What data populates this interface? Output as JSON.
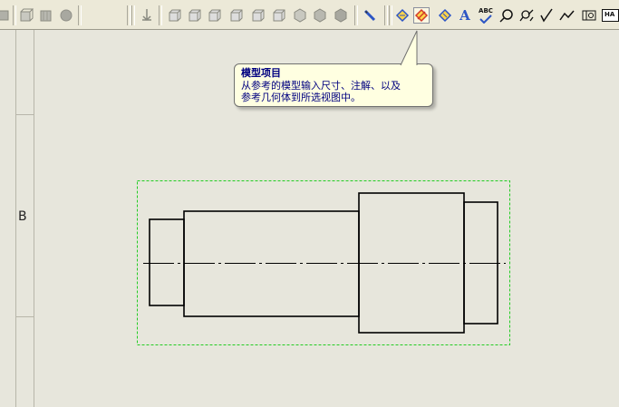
{
  "toolbar": {
    "tools": [
      {
        "name": "model-items"
      },
      {
        "name": "note"
      },
      {
        "name": "spell-checker"
      },
      {
        "name": "balloon"
      },
      {
        "name": "auto-balloon"
      },
      {
        "name": "surface-finish"
      },
      {
        "name": "weld-symbol"
      },
      {
        "name": "datum-feature"
      }
    ],
    "text_tool_glyph": "A",
    "spell_glyph": "ABC",
    "gtol_glyph": "HA"
  },
  "tooltip": {
    "title": "模型项目",
    "line1": "从参考的模型输入尺寸、注解、以及",
    "line2": "参考几何体到所选视图中。"
  },
  "sheet": {
    "zone_label": "B"
  },
  "colors": {
    "tooltip_bg": "#ffffe1",
    "tooltip_text": "#000080",
    "bounding_box": "#22cc22",
    "accent_blue": "#2c55c4"
  }
}
